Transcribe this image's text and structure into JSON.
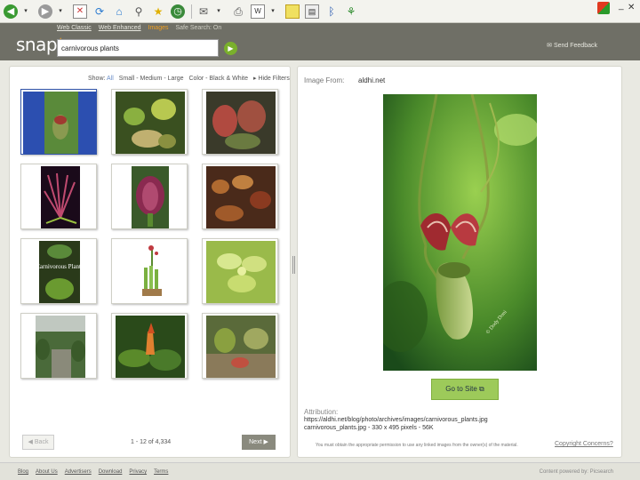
{
  "browser": {
    "toolbar_icons": [
      "back-icon",
      "forward-icon",
      "stop-icon",
      "refresh-icon",
      "home-icon",
      "search-icon",
      "favorites-icon",
      "history-icon",
      "mail-icon",
      "print-icon",
      "edit-icon",
      "messenger-icon",
      "folder-icon",
      "research-icon",
      "bluetooth-icon",
      "tools-icon"
    ],
    "controls": "_ ✕"
  },
  "header": {
    "logo": "snap",
    "nav": {
      "web_classic": "Web Classic",
      "web_enhanced": "Web Enhanced",
      "images": "Images",
      "safe_search": "Safe Search: On"
    },
    "search_value": "carnivorous plants",
    "go_glyph": "▶",
    "feedback": "Send Feedback"
  },
  "filters": {
    "show_label": "Show:",
    "all": "All",
    "size": "Small - Medium - Large",
    "color": "Color - Black & White",
    "hide": "Hide Filters"
  },
  "thumbnails": [
    {
      "desc": "pitcher plant on blue",
      "selected": true
    },
    {
      "desc": "venus flytraps cluster",
      "selected": false
    },
    {
      "desc": "venus flytrap red",
      "selected": false
    },
    {
      "desc": "sundew plant",
      "selected": false
    },
    {
      "desc": "venus flytrap close up",
      "selected": false
    },
    {
      "desc": "carnivorous plant bog",
      "selected": false
    },
    {
      "desc": "carnivorous plants book",
      "book_title": "Carnivorous Plants",
      "selected": false
    },
    {
      "desc": "potted pitcher plant",
      "selected": false
    },
    {
      "desc": "butterwort plant",
      "selected": false
    },
    {
      "desc": "greenhouse",
      "selected": false
    },
    {
      "desc": "heliconia plant",
      "selected": false
    },
    {
      "desc": "plants garden",
      "selected": false
    }
  ],
  "pagination": {
    "back": "Back",
    "range": "1 - 12 of 4,334",
    "next": "Next"
  },
  "detail": {
    "image_from_label": "Image From:",
    "image_from_value": "aldhi.net",
    "goto_label": "Go to Site",
    "attribution_label": "Attribution:",
    "attribution_url": "https://aldhi.net/blog/photo/archives/images/carnivorous_plants.jpg",
    "attribution_file": "carnivorous_plants.jpg - 330 x 495 pixels - 56K",
    "disclaimer": "You must obtain the appropriate permission to use any linked images from the owner(s) of the material.",
    "copyright": "Copyright Concerns?"
  },
  "footer": {
    "links": [
      "Blog",
      "About Us",
      "Advertisers",
      "Download",
      "Privacy",
      "Terms"
    ],
    "powered": "Content powered by: Picsearch"
  },
  "colors": {
    "header": "#6f6f66",
    "accent": "#f0a020",
    "go_button": "#9dca5a"
  }
}
